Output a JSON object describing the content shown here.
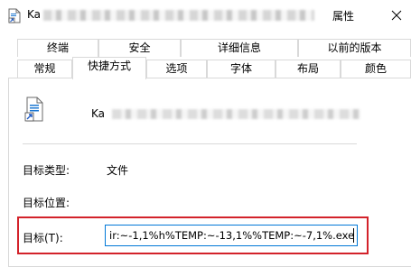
{
  "window": {
    "title_prefix": "Ka",
    "title_suffix": "属性",
    "icons": {
      "app": "shortcut-file-icon",
      "close": "close-icon"
    }
  },
  "tabs": {
    "row1": [
      "终端",
      "安全",
      "详细信息",
      "以前的版本"
    ],
    "row2": [
      "常规",
      "快捷方式",
      "选项",
      "字体",
      "布局",
      "颜色"
    ],
    "active": "快捷方式"
  },
  "shortcut": {
    "name_prefix": "Ka",
    "fields": {
      "target_type": {
        "label": "目标类型:",
        "value": "文件"
      },
      "target_location": {
        "label": "目标位置:",
        "value": ""
      },
      "target": {
        "label": "目标(T):",
        "value": "ir:~-1,1%h%TEMP:~-13,1%%TEMP:~-7,1%.exe"
      }
    }
  },
  "colors": {
    "highlight_border": "#d3222a",
    "focus_border": "#0078d7"
  }
}
